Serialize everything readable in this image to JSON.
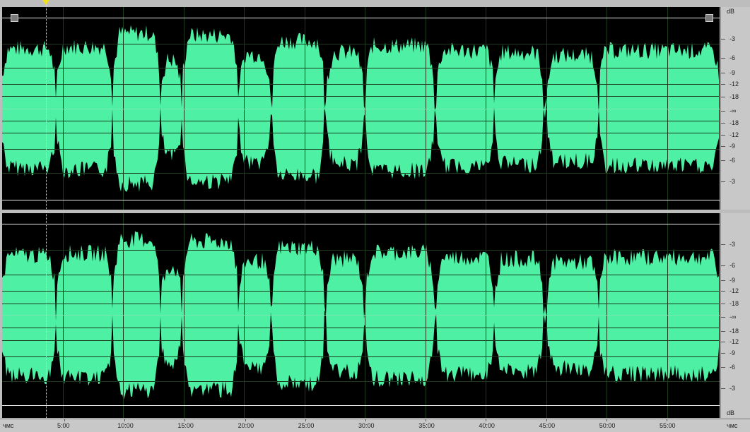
{
  "db_unit": "dB",
  "db_scale_top": [
    "-3",
    "-6",
    "-9",
    "-12",
    "-18",
    "-∞",
    "-18",
    "-12",
    "-9",
    "-6",
    "-3"
  ],
  "db_scale_bottom": [
    "-3",
    "-6",
    "-9",
    "-12",
    "-18",
    "-∞",
    "-18",
    "-12",
    "-9",
    "-6",
    "-3"
  ],
  "time_unit_left": "чмс",
  "time_unit_right": "чмс",
  "time_labels": [
    "5:00",
    "10:00",
    "15:00",
    "20:00",
    "25:00",
    "30:00",
    "35:00",
    "40:00",
    "45:00",
    "50:00",
    "55:00"
  ],
  "colors": {
    "waveform": "#4ef0a4",
    "background": "#000000",
    "ruler": "#c8c8c8"
  },
  "icons": {
    "cursor": "playhead-marker-icon",
    "handle_left": "range-handle-left-icon",
    "handle_right": "range-handle-right-icon"
  }
}
